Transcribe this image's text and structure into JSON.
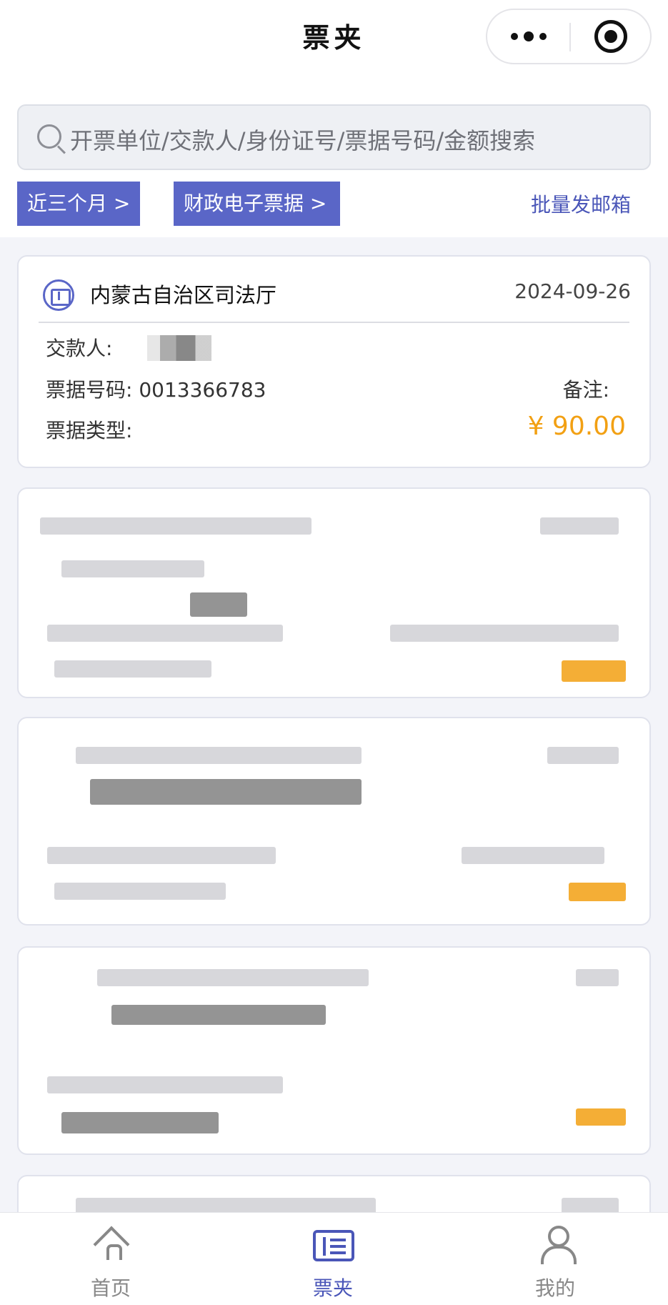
{
  "header": {
    "title": "票夹",
    "menu_icon": "more-dots-icon",
    "close_icon": "target-circle-icon"
  },
  "filters": {
    "search_placeholder": "开票单位/交款人/身份证号/票据号码/金额搜索",
    "period_chip": "近三个月 >",
    "type_chip": "财政电子票据 >",
    "batch_mail": "批量发邮箱"
  },
  "receipt": {
    "issuer": "内蒙古自治区司法厅",
    "date": "2024-09-26",
    "payer_label": "交款人:",
    "number_label": "票据号码:",
    "number": "0013366783",
    "note_label": "备注:",
    "type_label": "票据类型:",
    "amount": "¥ 90.00"
  },
  "tabs": [
    {
      "label": "首页",
      "icon": "home-icon"
    },
    {
      "label": "票夹",
      "icon": "ticket-folder-icon"
    },
    {
      "label": "我的",
      "icon": "user-icon"
    }
  ],
  "colors": {
    "accent": "#5a66c7",
    "accent_text": "#4a56b8",
    "amount": "#f2a013",
    "background": "#f3f4f9"
  }
}
